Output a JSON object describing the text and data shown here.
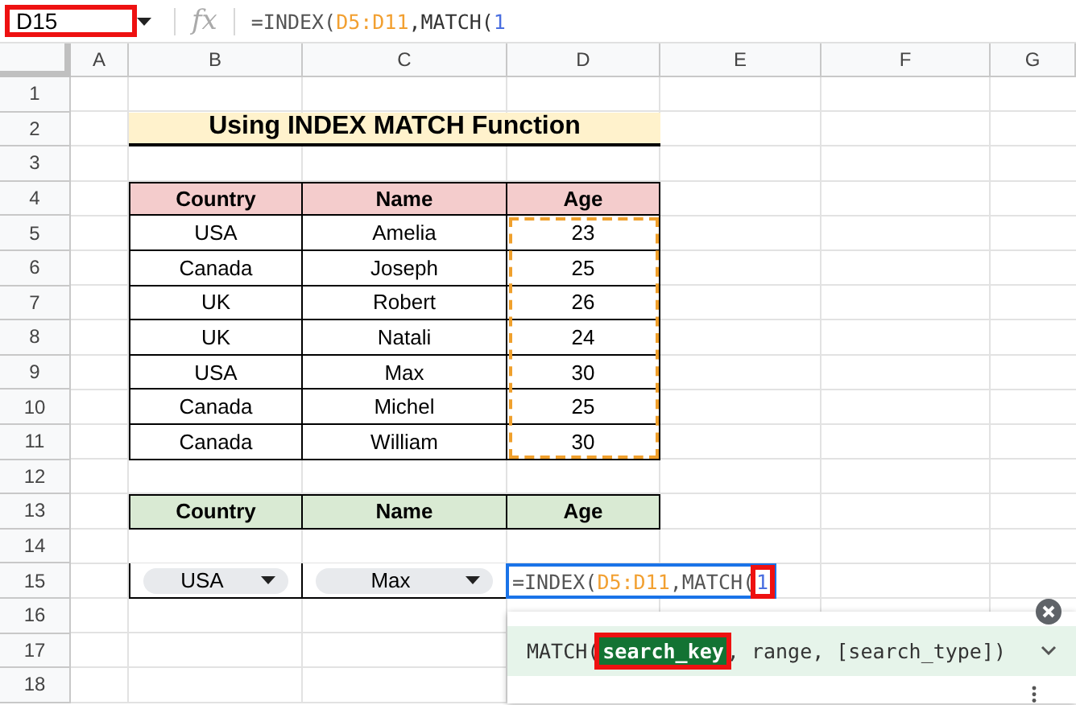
{
  "name_box": {
    "value": "D15",
    "highlighted": true
  },
  "formula_bar": {
    "fx": "fx",
    "parts": [
      {
        "text": "=INDEX(",
        "kind": "plain"
      },
      {
        "text": "D5:D11",
        "kind": "range"
      },
      {
        "text": ",MATCH(",
        "kind": "func"
      },
      {
        "text": "1",
        "kind": "arg"
      }
    ]
  },
  "columns": [
    "A",
    "B",
    "C",
    "D",
    "E",
    "F",
    "G"
  ],
  "rows": [
    "1",
    "2",
    "3",
    "4",
    "5",
    "6",
    "7",
    "8",
    "9",
    "10",
    "11",
    "12",
    "13",
    "14",
    "15",
    "16",
    "17",
    "18"
  ],
  "title": "Using INDEX MATCH Function",
  "table": {
    "headers": [
      "Country",
      "Name",
      "Age"
    ],
    "range_outlined": true,
    "rows": [
      [
        "USA",
        "Amelia",
        "23"
      ],
      [
        "Canada",
        "Joseph",
        "25"
      ],
      [
        "UK",
        "Robert",
        "26"
      ],
      [
        "UK",
        "Natali",
        "24"
      ],
      [
        "USA",
        "Max",
        "30"
      ],
      [
        "Canada",
        "Michel",
        "25"
      ],
      [
        "Canada",
        "William",
        "30"
      ]
    ]
  },
  "lookup": {
    "headers": [
      "Country",
      "Name",
      "Age"
    ],
    "dropdowns": [
      "USA",
      "Max"
    ],
    "editor_parts": [
      {
        "text": "=INDEX(",
        "kind": "plain"
      },
      {
        "text": "D5:D11",
        "kind": "range"
      },
      {
        "text": ",MATCH(",
        "kind": "plain"
      },
      {
        "text": "1",
        "kind": "arg",
        "highlighted": true
      }
    ]
  },
  "tooltip": {
    "prefix": "MATCH(",
    "active_arg": "search_key",
    "rest": ", range, [search_type])",
    "highlighted": true
  }
}
